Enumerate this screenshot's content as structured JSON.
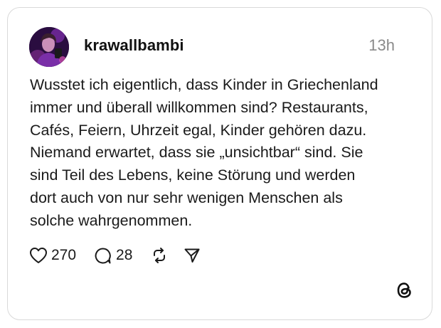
{
  "post": {
    "username": "krawallbambi",
    "timestamp": "13h",
    "text": "Wusstet ich eigentlich, dass Kinder in Griechenland\nimmer und überall willkommen sind? Restaurants,\nCafés, Feiern, Uhrzeit egal, Kinder gehören dazu.\nNiemand erwartet, dass sie „unsichtbar“ sind. Sie\nsind Teil des Lebens, keine Störung und werden\ndort auch von nur sehr wenigen Menschen als\nsolche wahrgenommen."
  },
  "actions": {
    "like_icon": "heart-icon",
    "like_count": "270",
    "reply_icon": "speech-bubble-icon",
    "reply_count": "28",
    "repost_icon": "repost-icon",
    "share_icon": "send-icon"
  },
  "branding": {
    "logo_icon": "threads-logo-icon"
  },
  "colors": {
    "text": "#1a1a1a",
    "muted": "#8a8a8a",
    "border": "#d9d9d9",
    "avatar_accent": "#b14be0"
  }
}
